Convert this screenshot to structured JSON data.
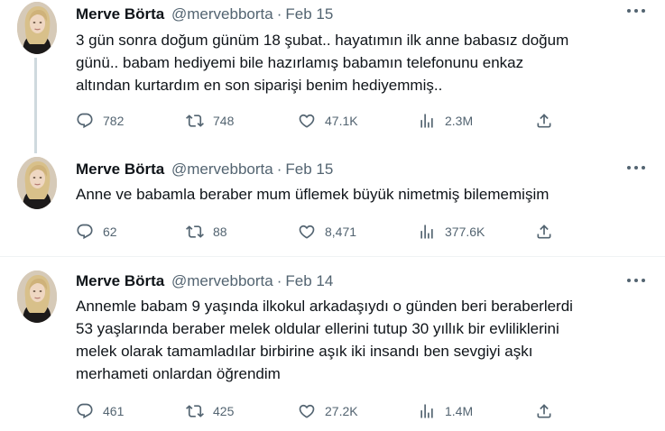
{
  "tweets": [
    {
      "author": {
        "name": "Merve Börta",
        "handle": "@mervebborta"
      },
      "separator": "·",
      "date": "Feb 15",
      "text_lines": [
        "3 gün sonra doğum günüm 18 şubat.. hayatımın ilk anne babasız doğum",
        "günü.. babam hediyemi bile hazırlamış babamın telefonunu enkaz",
        "altından kurtardım en son siparişi benim hediyemmiş.."
      ],
      "stats": {
        "replies": "782",
        "retweets": "748",
        "likes": "47.1K",
        "views": "2.3M"
      }
    },
    {
      "author": {
        "name": "Merve Börta",
        "handle": "@mervebborta"
      },
      "separator": "·",
      "date": "Feb 15",
      "text_lines": [
        "Anne ve babamla beraber mum üflemek büyük nimetmiş bilememişim"
      ],
      "stats": {
        "replies": "62",
        "retweets": "88",
        "likes": "8,471",
        "views": "377.6K"
      }
    },
    {
      "author": {
        "name": "Merve Börta",
        "handle": "@mervebborta"
      },
      "separator": "·",
      "date": "Feb 14",
      "text_lines": [
        "Annemle babam 9 yaşında ilkokul arkadaşıydı o günden beri beraberlerdi",
        "53 yaşlarında beraber melek oldular ellerini tutup 30 yıllık bir evliliklerini",
        "melek olarak tamamladılar birbirine aşık iki insandı ben sevgiyi aşkı",
        "merhameti onlardan öğrendim"
      ],
      "stats": {
        "replies": "461",
        "retweets": "425",
        "likes": "27.2K",
        "views": "1.4M"
      }
    }
  ],
  "icons": {
    "reply": "reply-icon",
    "retweet": "retweet-icon",
    "like": "like-icon",
    "views": "views-icon",
    "share": "share-icon",
    "more": "more-icon"
  },
  "colors": {
    "text": "#0f1419",
    "secondary": "#536471",
    "thread_line": "#cfd9de",
    "divider": "#eff3f4"
  }
}
